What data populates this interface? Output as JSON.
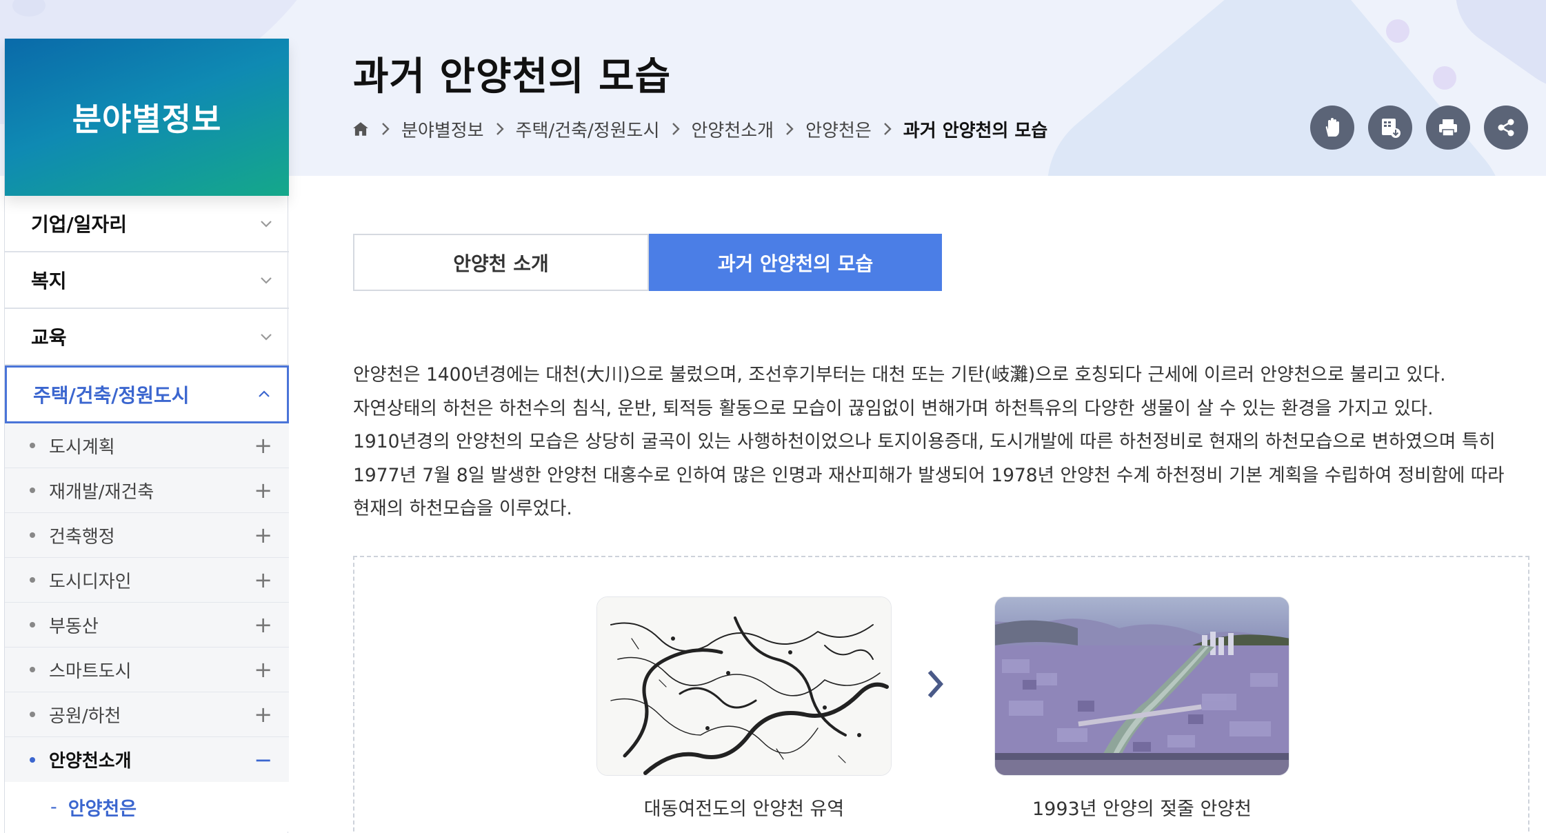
{
  "page": {
    "title": "과거 안양천의 모습"
  },
  "breadcrumb": {
    "home_icon": "home-icon",
    "items": [
      "분야별정보",
      "주택/건축/정원도시",
      "안양천소개",
      "안양천은",
      "과거 안양천의 모습"
    ]
  },
  "utility_buttons": [
    {
      "name": "hand-gesture-icon"
    },
    {
      "name": "download-icon"
    },
    {
      "name": "print-icon"
    },
    {
      "name": "share-icon"
    }
  ],
  "sidebar": {
    "title": "분야별정보",
    "menu": [
      {
        "label": "기업/일자리"
      },
      {
        "label": "복지"
      },
      {
        "label": "교육"
      },
      {
        "label": "주택/건축/정원도시"
      }
    ],
    "submenu": [
      {
        "label": "도시계획"
      },
      {
        "label": "재개발/재건축"
      },
      {
        "label": "건축행정"
      },
      {
        "label": "도시디자인"
      },
      {
        "label": "부동산"
      },
      {
        "label": "스마트도시"
      },
      {
        "label": "공원/하천"
      },
      {
        "label": "안양천소개"
      }
    ],
    "subsubmenu": [
      {
        "label": "안양천은"
      }
    ]
  },
  "tabs": [
    {
      "label": "안양천 소개"
    },
    {
      "label": "과거 안양천의 모습"
    }
  ],
  "content": {
    "paragraphs": [
      "안양천은 1400년경에는 대천(大川)으로 불렀으며, 조선후기부터는 대천 또는 기탄(岐灘)으로 호칭되다 근세에 이르러 안양천으로 불리고 있다.",
      "자연상태의 하천은 하천수의 침식, 운반, 퇴적등 활동으로 모습이 끊임없이 변해가며 하천특유의 다양한 생물이 살 수 있는 환경을 가지고 있다.",
      "1910년경의 안양천의 모습은 상당히 굴곡이 있는 사행하천이었으나 토지이용증대, 도시개발에 따른 하천정비로 현재의 하천모습으로 변하였으며 특히 1977년 7월 8일 발생한 안양천 대홍수로 인하여 많은 인명과 재산피해가 발생되어 1978년 안양천 수계 하천정비 기본 계획을 수립하여 정비함에 따라 현재의 하천모습을 이루었다."
    ]
  },
  "figures": [
    {
      "caption": "대동여전도의 안양천 유역"
    },
    {
      "caption": "1993년 안양의 젖줄 안양천"
    }
  ]
}
